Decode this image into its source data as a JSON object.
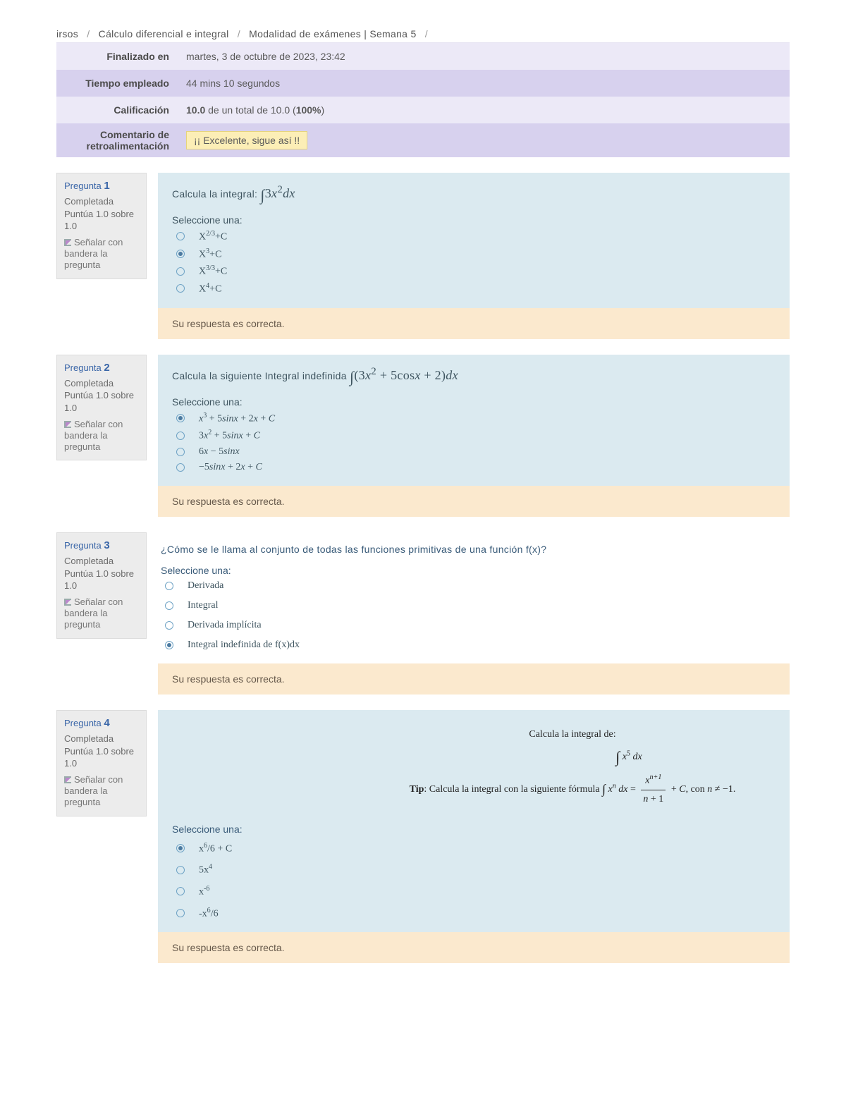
{
  "breadcrumb": {
    "item1": "irsos",
    "item2": "Cálculo diferencial e integral",
    "item3": "Modalidad de exámenes | Semana 5"
  },
  "summary": {
    "finished_label": "Finalizado en",
    "finished_value": "martes, 3 de octubre de 2023, 23:42",
    "time_label": "Tiempo empleado",
    "time_value": "44 mins 10 segundos",
    "grade_label": "Calificación",
    "grade_value_bold1": "10.0",
    "grade_value_mid": " de un total de 10.0 (",
    "grade_value_bold2": "100%",
    "grade_value_end": ")",
    "feedback_label": "Comentario de retroalimentación",
    "feedback_value": "¡¡ Excelente, sigue así !!"
  },
  "meta": {
    "pregunta_word": "Pregunta ",
    "completed": "Completada",
    "score_line": "Puntúa 1.0 sobre 1.0",
    "flag_text": "Señalar con bandera la pregunta"
  },
  "select_one": "Seleccione una:",
  "correct": "Su respuesta es correcta.",
  "q1": {
    "num": "1",
    "prompt_pre": "Calcula la integral:  ",
    "prompt_math": "∫ 3x²dx",
    "opts": [
      {
        "html": "X<sup>2/3</sup>+C",
        "sel": false
      },
      {
        "html": "X<sup>3</sup>+C",
        "sel": true
      },
      {
        "html": "X<sup>3/3</sup>+C",
        "sel": false
      },
      {
        "html": "X<sup>4</sup>+C",
        "sel": false
      }
    ]
  },
  "q2": {
    "num": "2",
    "prompt_pre": "Calcula la siguiente Integral indefinida ",
    "prompt_math": "∫ (3x² + 5cosx + 2)dx",
    "opts": [
      {
        "html": "<span class='ital'>x</span><sup>3</sup> + 5<span class='ital'>sinx</span> + 2<span class='ital'>x</span> + <span class='ital'>C</span>",
        "sel": true
      },
      {
        "html": "3<span class='ital'>x</span><sup>2</sup> + 5<span class='ital'>sinx</span> + <span class='ital'>C</span>",
        "sel": false
      },
      {
        "html": "6<span class='ital'>x</span> − 5<span class='ital'>sinx</span>",
        "sel": false
      },
      {
        "html": "−5<span class='ital'>sinx</span> + 2<span class='ital'>x</span> + <span class='ital'>C</span>",
        "sel": false
      }
    ]
  },
  "q3": {
    "num": "3",
    "prompt": "¿Cómo se le llama al conjunto de todas las funciones primitivas de una función f(x)?",
    "opts": [
      {
        "html": "Derivada",
        "sel": false
      },
      {
        "html": "Integral",
        "sel": false
      },
      {
        "html": "Derivada implícita",
        "sel": false
      },
      {
        "html": "Integral indefinida de f(x)dx",
        "sel": true
      }
    ]
  },
  "q4": {
    "num": "4",
    "tip_line1": "Calcula la integral de:",
    "tip_integral": "∫ x⁵ dx",
    "tip_pre": "Tip",
    "tip_text": ": Calcula la integral con la siguiente fórmula ",
    "tip_formula_lhs": "∫ xⁿ dx = ",
    "tip_formula_frac_top": "xⁿ⁺¹",
    "tip_formula_frac_bot": "n + 1",
    "tip_tail": " + C, con n ≠ −1.",
    "opts": [
      {
        "html": "x<sup>6</sup>/6 + C",
        "sel": true
      },
      {
        "html": "5x<sup>4</sup>",
        "sel": false
      },
      {
        "html": "x<sup>-6</sup>",
        "sel": false
      },
      {
        "html": "-x<sup>6</sup>/6",
        "sel": false
      }
    ]
  }
}
